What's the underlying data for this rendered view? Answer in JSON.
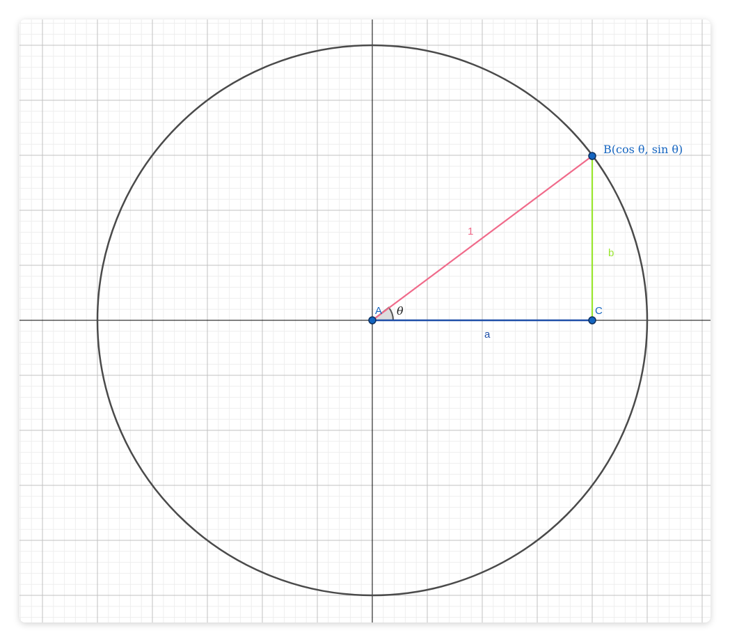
{
  "colors": {
    "minor_grid": "#eeeeee",
    "major_grid": "#c0c0c0",
    "axis": "#000000",
    "circle": "#4a4a4a",
    "radius": "#f06a8a",
    "adjacent": "#1f4fa8",
    "opposite": "#99e62e",
    "point_fill": "#1565c0",
    "point_stroke": "#0d2f5e",
    "angle_fill": "#dddddd",
    "angle_stroke": "#555555",
    "point_label": "#1565c0",
    "radius_label": "#f06a8a",
    "adjacent_label": "#1f4fa8",
    "opposite_label": "#99e62e",
    "theta_label": "#222222"
  },
  "points": {
    "A": {
      "label": "A"
    },
    "B": {
      "label": "B(cos θ, sin θ)"
    },
    "C": {
      "label": "C"
    }
  },
  "segments": {
    "radius_label": "1",
    "adjacent_label": "a",
    "opposite_label": "b"
  },
  "angle": {
    "label": "θ"
  }
}
